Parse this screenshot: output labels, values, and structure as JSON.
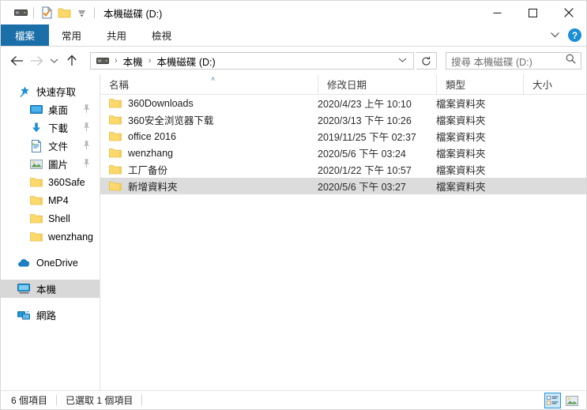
{
  "window": {
    "title": "本機磁碟 (D:)",
    "quick_access_toolbar": [
      {
        "name": "drive-icon"
      },
      {
        "name": "properties-icon"
      },
      {
        "name": "new-folder-icon"
      },
      {
        "name": "customize-dropdown-icon"
      }
    ],
    "controls": {
      "minimize": "–",
      "maximize": "□",
      "close": "✕"
    }
  },
  "ribbon": {
    "tabs": [
      {
        "label": "檔案",
        "active": true
      },
      {
        "label": "常用",
        "active": false
      },
      {
        "label": "共用",
        "active": false
      },
      {
        "label": "檢視",
        "active": false
      }
    ],
    "collapse_icon": "⌄",
    "help_label": "?"
  },
  "address": {
    "back_icon": "←",
    "forward_icon": "→",
    "recent_icon": "⌄",
    "up_icon": "↑",
    "breadcrumbs": [
      "本機",
      "本機磁碟 (D:)"
    ],
    "separator": "›",
    "dropdown_icon": "⌄",
    "refresh_icon": "↻"
  },
  "search": {
    "placeholder": "搜尋 本機磁碟 (D:)",
    "icon": "search-icon"
  },
  "sidebar": {
    "quick_access": {
      "label": "快速存取",
      "icon": "pin-star-icon"
    },
    "pinned": [
      {
        "label": "桌面",
        "icon": "desktop-icon",
        "pinned": true
      },
      {
        "label": "下載",
        "icon": "downloads-icon",
        "pinned": true
      },
      {
        "label": "文件",
        "icon": "documents-icon",
        "pinned": true
      },
      {
        "label": "圖片",
        "icon": "pictures-icon",
        "pinned": true
      },
      {
        "label": "360Safe",
        "icon": "folder-icon",
        "pinned": false
      },
      {
        "label": "MP4",
        "icon": "folder-icon",
        "pinned": false
      },
      {
        "label": "Shell",
        "icon": "folder-icon",
        "pinned": false
      },
      {
        "label": "wenzhang",
        "icon": "folder-icon",
        "pinned": false
      }
    ],
    "onedrive": {
      "label": "OneDrive",
      "icon": "cloud-icon"
    },
    "this_pc": {
      "label": "本機",
      "icon": "computer-icon",
      "selected": true
    },
    "network": {
      "label": "網路",
      "icon": "network-icon"
    }
  },
  "filelist": {
    "columns": [
      {
        "key": "name",
        "label": "名稱",
        "sorted": "asc"
      },
      {
        "key": "date",
        "label": "修改日期"
      },
      {
        "key": "type",
        "label": "類型"
      },
      {
        "key": "size",
        "label": "大小"
      }
    ],
    "sort_caret": "˄",
    "rows": [
      {
        "name": "360Downloads",
        "date": "2020/4/23 上午 10:10",
        "type": "檔案資料夾",
        "size": "",
        "selected": false
      },
      {
        "name": "360安全浏览器下载",
        "date": "2020/3/13 下午 10:26",
        "type": "檔案資料夾",
        "size": "",
        "selected": false
      },
      {
        "name": "office 2016",
        "date": "2019/11/25 下午 02:37",
        "type": "檔案資料夾",
        "size": "",
        "selected": false
      },
      {
        "name": "wenzhang",
        "date": "2020/5/6 下午 03:24",
        "type": "檔案資料夾",
        "size": "",
        "selected": false
      },
      {
        "name": "工厂备份",
        "date": "2020/1/22 下午 10:57",
        "type": "檔案資料夾",
        "size": "",
        "selected": false
      },
      {
        "name": "新增資料夾",
        "date": "2020/5/6 下午 03:27",
        "type": "檔案資料夾",
        "size": "",
        "selected": true
      }
    ]
  },
  "scrollbar": {
    "left_arrow": "‹",
    "right_arrow": "›"
  },
  "statusbar": {
    "item_count": "6 個項目",
    "selection": "已選取 1 個項目",
    "views": [
      {
        "name": "details-view",
        "active": true
      },
      {
        "name": "large-icons-view",
        "active": false
      }
    ]
  },
  "colors": {
    "accent": "#1a6fa8",
    "folder": "#fdd96b",
    "selection": "#dcdcdc",
    "nav_selection": "#d8d8d8",
    "help_blue": "#1b8fd6"
  }
}
